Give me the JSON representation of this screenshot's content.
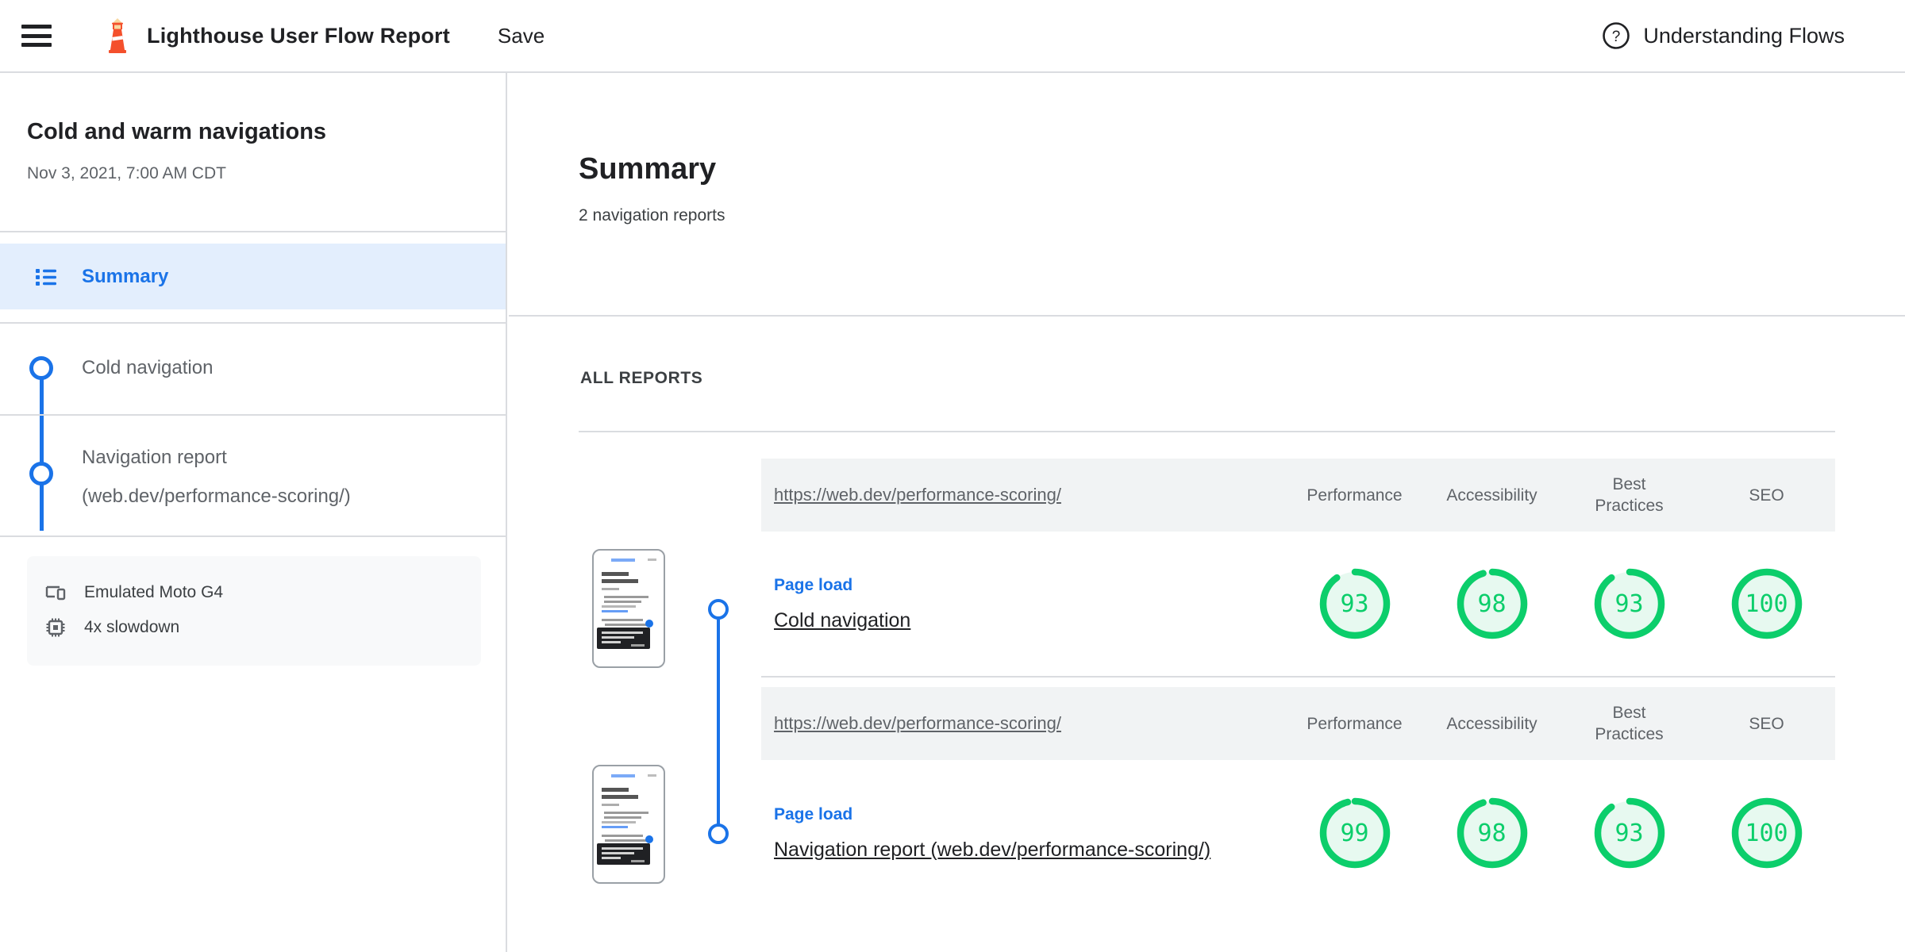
{
  "header": {
    "title": "Lighthouse User Flow Report",
    "save_label": "Save",
    "help_label": "Understanding Flows",
    "menu_icon": "hamburger-menu",
    "logo_icon": "lighthouse-logo",
    "help_icon": "question-mark-circle"
  },
  "sidebar": {
    "flow_title": "Cold and warm navigations",
    "timestamp": "Nov 3, 2021, 7:00 AM CDT",
    "summary": {
      "label": "Summary",
      "icon": "list-icon"
    },
    "steps": [
      {
        "label": "Cold navigation"
      },
      {
        "label_line1": "Navigation report",
        "label_line2": "(web.dev/performance-scoring/)"
      }
    ],
    "environment": {
      "device": "Emulated Moto G4",
      "device_icon": "devices-icon",
      "throttle": "4x slowdown",
      "throttle_icon": "cpu-chip-icon"
    }
  },
  "main": {
    "title": "Summary",
    "subtitle": "2 navigation reports",
    "all_reports_label": "ALL REPORTS",
    "score_columns": [
      "Performance",
      "Accessibility",
      "Best Practices",
      "SEO"
    ],
    "reports": [
      {
        "url": "https://web.dev/performance-scoring/",
        "step_type": "Page load",
        "name": "Cold navigation",
        "scores": [
          93,
          98,
          93,
          100
        ]
      },
      {
        "url": "https://web.dev/performance-scoring/",
        "step_type": "Page load",
        "name": "Navigation report (web.dev/performance-scoring/)",
        "scores": [
          99,
          98,
          93,
          100
        ]
      }
    ]
  },
  "colors": {
    "accent_blue": "#1a73e8",
    "score_pass_green": "#0cce6b",
    "score_fill_green": "#e7f9f0",
    "header_row_gray": "#f1f3f4",
    "highlight_blue": "#e3eefd"
  }
}
